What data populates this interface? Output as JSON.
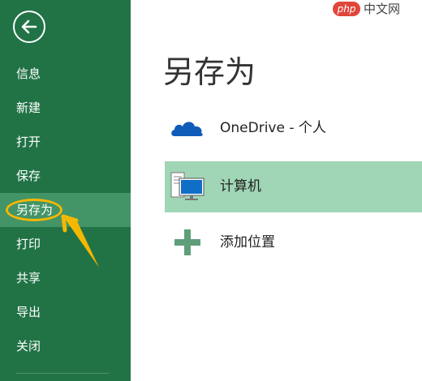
{
  "sidebar": {
    "items": [
      {
        "label": "信息"
      },
      {
        "label": "新建"
      },
      {
        "label": "打开"
      },
      {
        "label": "保存"
      },
      {
        "label": "另存为"
      },
      {
        "label": "打印"
      },
      {
        "label": "共享"
      },
      {
        "label": "导出"
      },
      {
        "label": "关闭"
      }
    ],
    "active_label": "另存为",
    "back_icon": "back-arrow-icon"
  },
  "main": {
    "title": "另存为",
    "locations": [
      {
        "label": "OneDrive - 个人",
        "icon": "onedrive-cloud-icon"
      },
      {
        "label": "计算机",
        "icon": "computer-icon",
        "selected": true
      },
      {
        "label": "添加位置",
        "icon": "plus-icon"
      }
    ]
  },
  "watermark": {
    "badge": "php",
    "text": "中文网"
  },
  "colors": {
    "sidebar_bg": "#217346",
    "sidebar_active": "#439467",
    "selected_location": "#a0d6b6",
    "annotation": "#f5b800",
    "cloud": "#0f5cb8",
    "plus": "#5e9f7a"
  }
}
